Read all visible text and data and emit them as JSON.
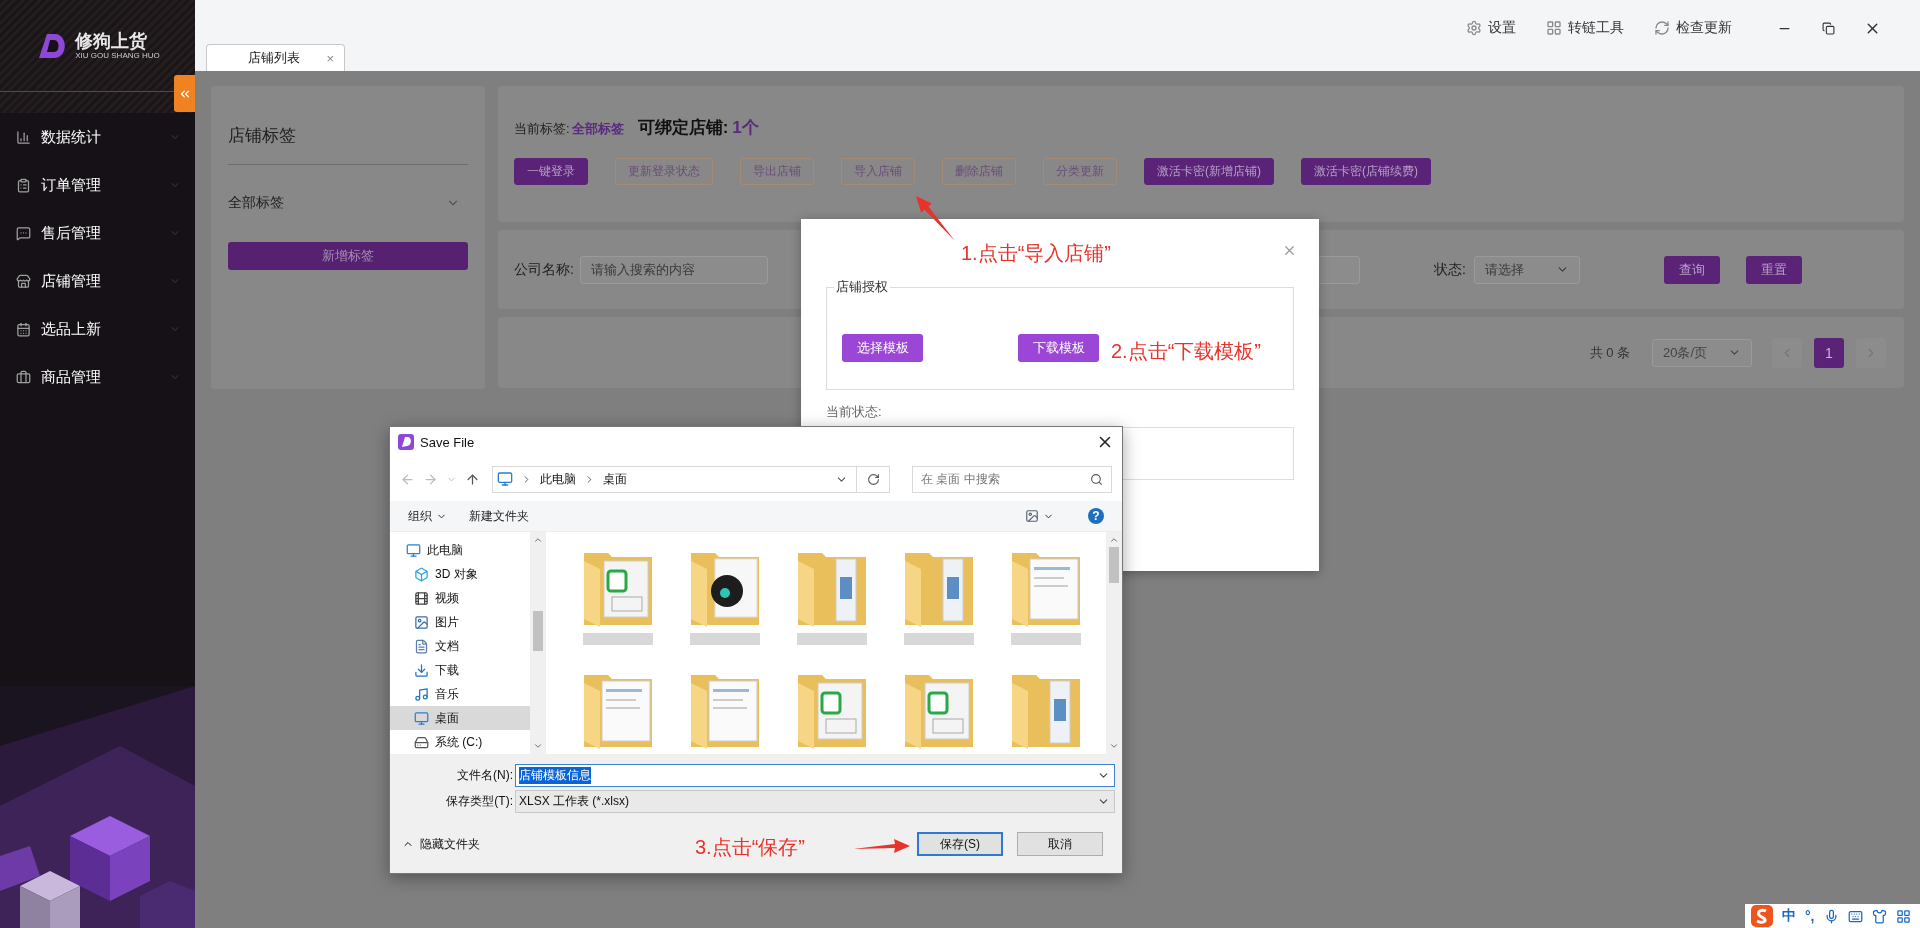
{
  "sidebar": {
    "logo": {
      "name": "修狗上货",
      "subtitle": "XIU GOU SHANG HUO"
    },
    "items": [
      {
        "label": "数据统计"
      },
      {
        "label": "订单管理"
      },
      {
        "label": "售后管理"
      },
      {
        "label": "店铺管理"
      },
      {
        "label": "选品上新"
      },
      {
        "label": "商品管理"
      }
    ]
  },
  "toolbar": {
    "actions": [
      {
        "label": "设置"
      },
      {
        "label": "转链工具"
      },
      {
        "label": "检查更新"
      }
    ]
  },
  "tabs": [
    {
      "label": "店铺列表",
      "selected": true,
      "close": "×"
    }
  ],
  "tag_panel": {
    "title": "店铺标签",
    "filter": "全部标签",
    "button": "新增标签"
  },
  "summary": {
    "current_tag_label": "当前标签:",
    "current_tag": "全部标签",
    "bindable_label": "可绑定店铺:",
    "bindable_count": "1个"
  },
  "actions": [
    {
      "label": "一键登录",
      "kind": "primary"
    },
    {
      "label": "更新登录状态",
      "kind": "outline"
    },
    {
      "label": "导出店铺",
      "kind": "outline"
    },
    {
      "label": "导入店铺",
      "kind": "outline"
    },
    {
      "label": "删除店铺",
      "kind": "outline"
    },
    {
      "label": "分类更新",
      "kind": "outline"
    },
    {
      "label": "激活卡密(新增店铺)",
      "kind": "primary"
    },
    {
      "label": "激活卡密(店铺续费)",
      "kind": "primary"
    }
  ],
  "filters": {
    "company_label": "公司名称:",
    "company_placeholder": "请输入搜索的内容",
    "status_label": "状态:",
    "status_placeholder": "请选择",
    "buttons": [
      "查询",
      "重置"
    ]
  },
  "pagination": {
    "total": "共 0 条",
    "page_size": "20条/页",
    "pages": [
      {
        "label": "1",
        "selected": true
      }
    ]
  },
  "import_modal": {
    "section_title": "店铺授权",
    "buttons": [
      "选择模板",
      "下载模板"
    ],
    "status_label": "当前状态:"
  },
  "save_dialog": {
    "title": "Save File",
    "path": [
      "此电脑",
      "桌面"
    ],
    "search_placeholder": "在 桌面 中搜索",
    "organize": "组织",
    "new_folder": "新建文件夹",
    "help": "?",
    "tree": [
      {
        "label": "此电脑",
        "selected": false,
        "children": [
          {
            "label": "3D 对象",
            "selected": false
          },
          {
            "label": "视频",
            "selected": false
          },
          {
            "label": "图片",
            "selected": false
          },
          {
            "label": "文档",
            "selected": false
          },
          {
            "label": "下载",
            "selected": false
          },
          {
            "label": "音乐",
            "selected": false
          },
          {
            "label": "桌面",
            "selected": true
          },
          {
            "label": "系统 (C:)",
            "selected": false
          }
        ]
      }
    ],
    "files": [
      {
        "kind": "sheet"
      },
      {
        "kind": "app"
      },
      {
        "kind": "docs"
      },
      {
        "kind": "docs"
      },
      {
        "kind": "pages"
      },
      {
        "kind": "pages"
      },
      {
        "kind": "pages"
      },
      {
        "kind": "sheet"
      },
      {
        "kind": "sheet"
      },
      {
        "kind": "docs"
      }
    ],
    "file_name_label": "文件名(N):",
    "file_name": "店铺模板信息",
    "file_name_highlighted": true,
    "file_type_label": "保存类型(T):",
    "file_type": "XLSX 工作表 (*.xlsx)",
    "hide_folders": "隐藏文件夹",
    "buttons": [
      {
        "label": "保存(S)",
        "default": true
      },
      {
        "label": "取消",
        "default": false
      }
    ]
  },
  "annotations": [
    {
      "text": "1.点击“导入店铺”"
    },
    {
      "text": "2.点击“下载模板”"
    },
    {
      "text": "3.点击“保存”"
    }
  ],
  "ime": {
    "mode": "中",
    "punctuation": "°,"
  }
}
